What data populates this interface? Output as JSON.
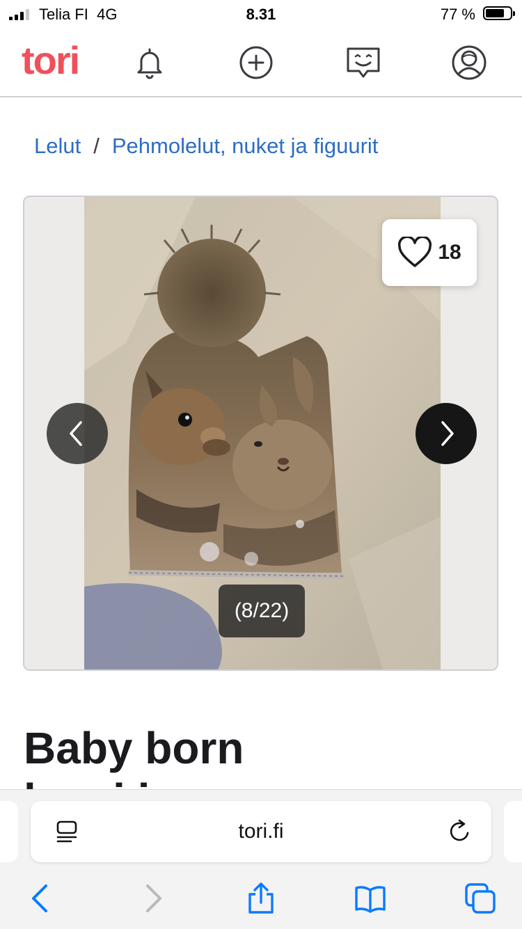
{
  "status_bar": {
    "carrier": "Telia FI",
    "network": "4G",
    "time": "8.31",
    "battery_text": "77 %",
    "battery_level": 0.77,
    "signal_bars": 3,
    "signal_bars_total": 4
  },
  "header": {
    "logo": "tori",
    "brand_color": "#f0505c",
    "icons": [
      "bell-icon",
      "plus-circle-icon",
      "chat-icon",
      "user-icon"
    ]
  },
  "breadcrumb": {
    "items": [
      "Lelut",
      "Pehmolelut, nuket ja figuurit"
    ],
    "separator": "/",
    "link_color": "#2d6dc4"
  },
  "gallery": {
    "favorite_count": "18",
    "counter": "(8/22)",
    "image_index": 8,
    "image_total": 22
  },
  "listing": {
    "title": "Baby born",
    "title_next_line_peek": "lapsi ja"
  },
  "safari": {
    "url": "tori.fi",
    "toolbar_icons": [
      "back-icon",
      "forward-icon",
      "share-icon",
      "bookmarks-icon",
      "tabs-icon"
    ],
    "accent_color": "#0a7aff"
  }
}
